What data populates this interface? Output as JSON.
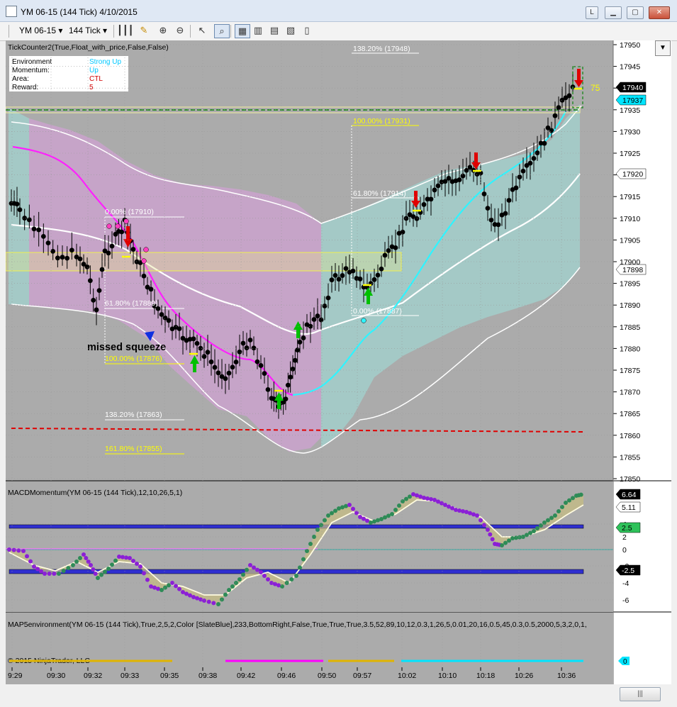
{
  "window": {
    "title": "YM 06-15 (144 Tick)  4/10/2015",
    "btn_l": "L"
  },
  "toolbar": {
    "instrument": "YM 06-15",
    "interval": "144 Tick",
    "dropdown_glyph": "▾"
  },
  "price_panel": {
    "indicator_label": "TickCounter2(True,Float_with_price,False,False)",
    "axis_ticks": [
      "17950",
      "17945",
      "17940",
      "17935",
      "17930",
      "17925",
      "17920",
      "17915",
      "17910",
      "17905",
      "17900",
      "17895",
      "17890",
      "17885",
      "17880",
      "17875",
      "17870",
      "17865",
      "17860",
      "17855",
      "17850"
    ],
    "environment_box": {
      "rows": [
        {
          "label": "Environment",
          "value": "Strong Up",
          "color": "#00c8ff"
        },
        {
          "label": "Momentum:",
          "value": "Up",
          "color": "#00c8ff"
        },
        {
          "label": "Area:",
          "value": "CTL",
          "color": "#d00000"
        },
        {
          "label": "Reward:",
          "value": "5",
          "color": "#d00000"
        }
      ]
    },
    "fib_labels_left": [
      "0.00% (17910)",
      "61.80% (17889)",
      "100.00% (17876)",
      "138.20% (17863)",
      "161.80% (17855)"
    ],
    "fib_labels_right": [
      "138.20% (17948)",
      "100.00% (17931)",
      "61.80% (17914)",
      "0.00% (17887)"
    ],
    "annotation": "missed squeeze",
    "tick_count": "75",
    "price_tags": [
      {
        "text": "17940",
        "bg": "#000000",
        "fg": "#ffffff"
      },
      {
        "text": "17937",
        "bg": "#00e5ff",
        "fg": "#000000"
      },
      {
        "text": "17920",
        "bg": "#ffffff",
        "fg": "#000000"
      },
      {
        "text": "17898",
        "bg": "#ffffff",
        "fg": "#000000"
      }
    ]
  },
  "macd_panel": {
    "indicator_label": "MACDMomentum(YM 06-15 (144 Tick),12,10,26,5,1)",
    "axis_ticks": [
      "4",
      "2",
      "0",
      "-2",
      "-4",
      "-6"
    ],
    "price_tags": [
      {
        "text": "6.64",
        "bg": "#000000",
        "fg": "#ffffff"
      },
      {
        "text": "5.11",
        "bg": "#ffffff",
        "fg": "#000000"
      },
      {
        "text": "2.5",
        "bg": "#2ec25a",
        "fg": "#000000"
      },
      {
        "text": "-2.5",
        "bg": "#000000",
        "fg": "#ffffff"
      }
    ]
  },
  "env_panel": {
    "indicator_label": "MAP5environment(YM 06-15 (144 Tick),True,2,5,2,Color [SlateBlue],233,BottomRight,False,True,True,True,3.5,52,89,10,12,0.3,1,26,5,0.01,20,16,0.5,45,0.3,0.5,2000,5,3,2,0,1,",
    "copyright": "© 2015 NinjaTrader, LLC",
    "tag": "0"
  },
  "time_axis": [
    "9:29",
    "09:30",
    "09:32",
    "09:33",
    "09:35",
    "09:38",
    "09:42",
    "09:46",
    "09:50",
    "09:57",
    "10:02",
    "10:10",
    "10:18",
    "10:26",
    "10:36"
  ],
  "colors": {
    "chart_bg": "#ababab",
    "purple_zone": "#c6a4c8",
    "teal_zone": "#a4c9c6",
    "band_line": "#ffffff",
    "magenta_ma": "#ff00ff",
    "cyan_ma": "#00ffff",
    "red_support": "#e00000"
  }
}
